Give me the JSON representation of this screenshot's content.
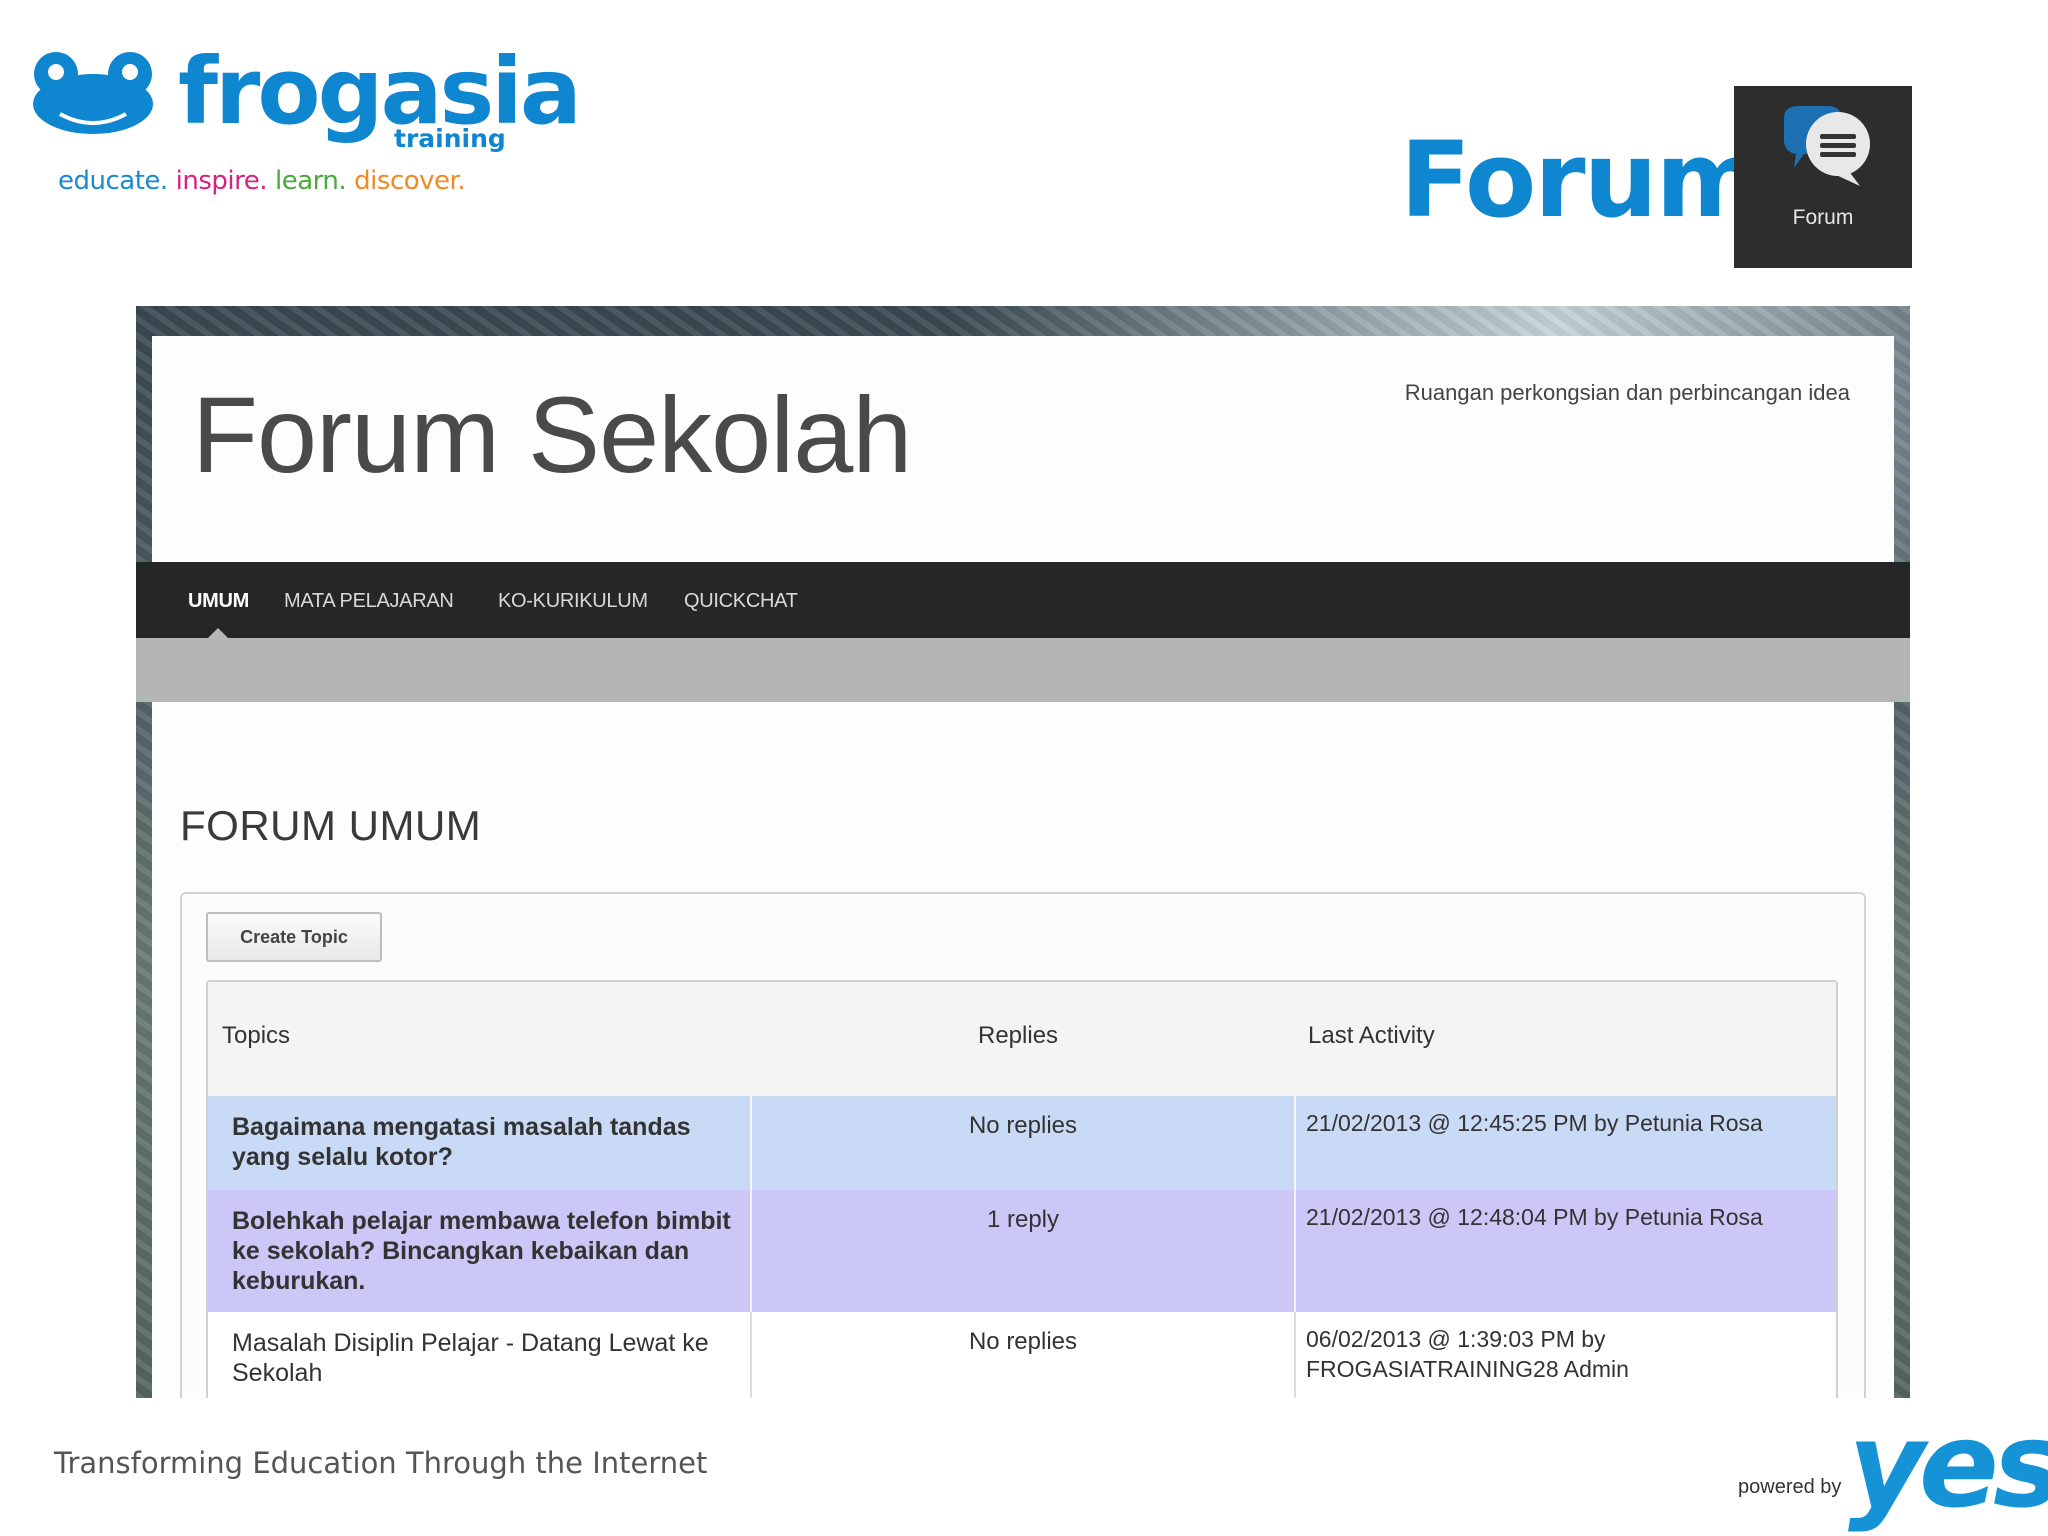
{
  "brand": {
    "name": "frogasia",
    "sub": "training",
    "tagline": [
      {
        "text": "educate.",
        "color": "#1a8ad2"
      },
      {
        "text": "inspire.",
        "color": "#d6237f"
      },
      {
        "text": "learn.",
        "color": "#4aa93c"
      },
      {
        "text": "discover.",
        "color": "#f08a24"
      }
    ],
    "color": "#0f86d0"
  },
  "slide": {
    "title": "Forum",
    "app_tile_label": "Forum",
    "app_tile_icon": "speech-bubbles-icon"
  },
  "site": {
    "title": "Forum Sekolah",
    "description": "Ruangan perkongsian dan perbincangan idea"
  },
  "nav": {
    "items": [
      {
        "label": "UMUM",
        "active": true
      },
      {
        "label": "MATA PELAJARAN",
        "active": false
      },
      {
        "label": "KO-KURIKULUM",
        "active": false
      },
      {
        "label": "QUICKCHAT",
        "active": false
      }
    ]
  },
  "forum": {
    "section_title": "FORUM UMUM",
    "create_label": "Create Topic",
    "columns": [
      "Topics",
      "Replies",
      "Last Activity"
    ],
    "rows": [
      {
        "topic": "Bagaimana mengatasi masalah tandas yang selalu kotor?",
        "replies": "No replies",
        "activity": "21/02/2013 @ 12:45:25 PM by Petunia Rosa",
        "highlight": "#c9daf7"
      },
      {
        "topic": "Bolehkah pelajar membawa telefon bimbit ke sekolah? Bincangkan kebaikan dan keburukan.",
        "replies": "1 reply",
        "activity": "21/02/2013 @ 12:48:04 PM by Petunia Rosa",
        "highlight": "#cbc7f6"
      },
      {
        "topic": "Masalah Disiplin Pelajar - Datang Lewat ke Sekolah",
        "replies": "No replies",
        "activity": "06/02/2013 @ 1:39:03 PM by FROGASIATRAINING28 Admin",
        "highlight": "#ffffff"
      }
    ]
  },
  "footer": {
    "text": "Transforming Education Through the Internet",
    "powered": "powered by",
    "partner": "yes",
    "partner_color": "#1593d6"
  }
}
